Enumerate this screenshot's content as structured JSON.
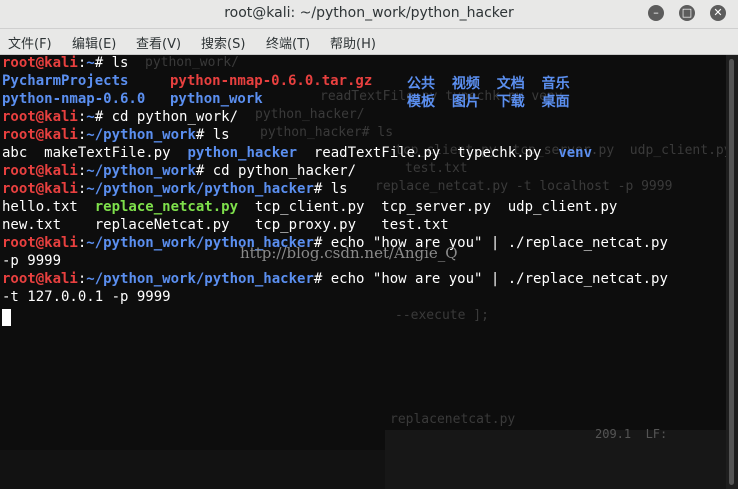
{
  "window": {
    "title": "root@kali: ~/python_work/python_hacker",
    "buttons": {
      "minimize": "–",
      "maximize": "□",
      "close": "✕"
    }
  },
  "menubar": {
    "items": [
      "文件(F)",
      "编辑(E)",
      "查看(V)",
      "搜索(S)",
      "终端(T)",
      "帮助(H)"
    ]
  },
  "terminal": {
    "prompt_user": "root@kali",
    "prompt_colon": ":",
    "prompt_home": "~",
    "prompt_sep": "#",
    "lines": {
      "l1_cmd": " ls",
      "l2_a": "PycharmProjects",
      "l2_b": "python-nmap-0.6.0.tar.gz",
      "l2_c": "公共  视频  文档  音乐",
      "l3_a": "python-nmap-0.6.0",
      "l3_b": "python_work",
      "l3_c": "模板  图片  下载  桌面",
      "l4_cmd": " cd python_work/",
      "l5_path": "~/python_work",
      "l5_cmd": " ls",
      "l6_a": "abc  makeTextFile.py  ",
      "l6_b": "python_hacker",
      "l6_c": "  readTextFile.py  typechk.py  ",
      "l6_d": "venv",
      "l7_cmd": " cd python_hacker/",
      "l8_path": "~/python_work/python_hacker",
      "l8_cmd": " ls",
      "l9_a": "hello.txt  ",
      "l9_b": "replace_netcat.py",
      "l9_c": "  tcp_client.py  tcp_server.py  udp_client.py",
      "l10": "new.txt    replaceNetcat.py   tcp_proxy.py   test.txt",
      "l11_cmd": " echo \"how are you\" | ./replace_netcat.py",
      "l12": "-p 9999",
      "l13_cmd": " echo \"how are you\" | ./replace_netcat.py",
      "l14": "-t 127.0.0.1 -p 9999"
    },
    "watermark": "http://blog.csdn.net/Angie_Q"
  },
  "ghost": {
    "g1": "python_work/",
    "g2": "readTextFile.py typechk.py venv",
    "g3": "python_hacker/",
    "g4": "python_hacker# ls",
    "g5": "tcp_client.py  tcp_server.py  udp_client.py",
    "g6": "replace_netcat.py -t localhost -p 9999",
    "g7": "test.txt",
    "g8": "--execute ];",
    "g9": "replacenetcat.py",
    "g10": "209.1  LF:"
  }
}
